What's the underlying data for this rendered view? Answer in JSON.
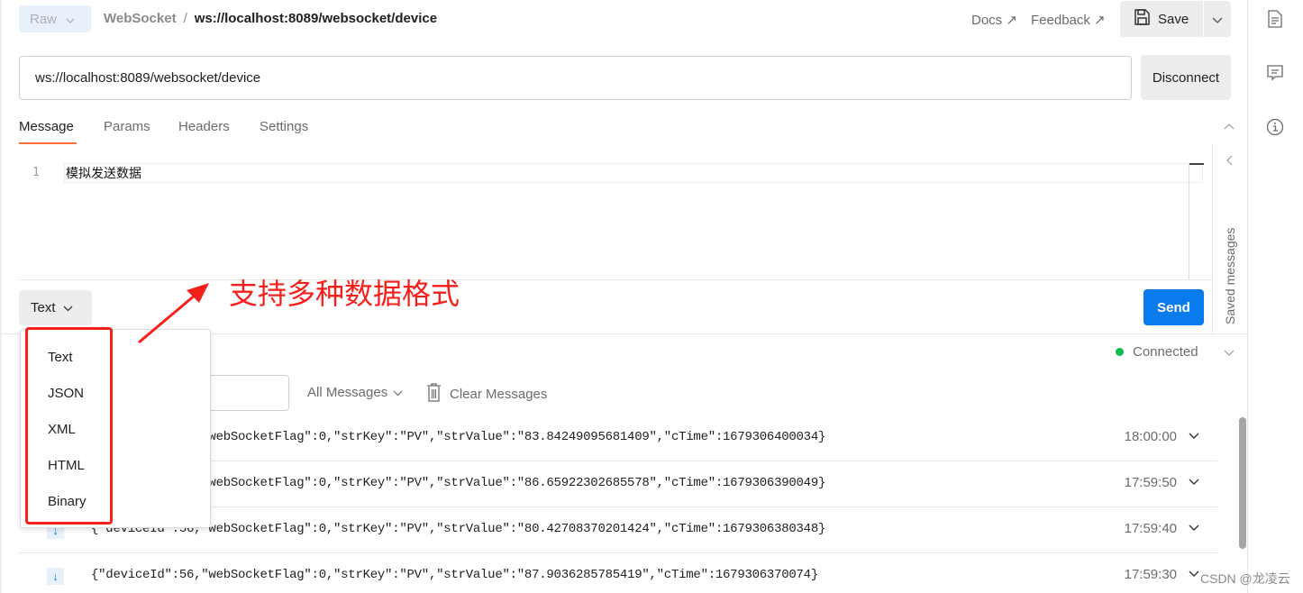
{
  "header": {
    "mode_button": "Raw",
    "breadcrumb": {
      "parent": "WebSocket",
      "separator": "/",
      "current": "ws://localhost:8089/websocket/device"
    },
    "docs_link": "Docs ↗",
    "feedback_link": "Feedback ↗",
    "save_label": "Save"
  },
  "request": {
    "url": "ws://localhost:8089/websocket/device",
    "disconnect_label": "Disconnect"
  },
  "tabs": [
    {
      "label": "Message",
      "active": true
    },
    {
      "label": "Params",
      "active": false
    },
    {
      "label": "Headers",
      "active": false
    },
    {
      "label": "Settings",
      "active": false
    }
  ],
  "editor": {
    "line_number": "1",
    "content": "模拟发送数据"
  },
  "saved_messages_label": "Saved messages",
  "format": {
    "selected": "Text",
    "options": [
      "Text",
      "JSON",
      "XML",
      "HTML",
      "Binary"
    ]
  },
  "send_label": "Send",
  "response": {
    "status": "Connected",
    "status_color": "#0cbb52",
    "filter_label": "All Messages",
    "clear_label": "Clear Messages",
    "messages": [
      {
        "text": "{\"deviceId\":56,\"webSocketFlag\":0,\"strKey\":\"PV\",\"strValue\":\"83.84249095681409\",\"cTime\":1679306400034}",
        "time": "18:00:00"
      },
      {
        "text": "{\"deviceId\":56,\"webSocketFlag\":0,\"strKey\":\"PV\",\"strValue\":\"86.65922302685578\",\"cTime\":1679306390049}",
        "time": "17:59:50"
      },
      {
        "text": "{\"deviceId\":56,\"webSocketFlag\":0,\"strKey\":\"PV\",\"strValue\":\"80.42708370201424\",\"cTime\":1679306380348}",
        "time": "17:59:40"
      },
      {
        "text": "{\"deviceId\":56,\"webSocketFlag\":0,\"strKey\":\"PV\",\"strValue\":\"87.9036285785419\",\"cTime\":1679306370074}",
        "time": "17:59:30"
      }
    ]
  },
  "annotation": {
    "text": "支持多种数据格式",
    "color": "#f5201b"
  },
  "watermark": "CSDN @龙凌云",
  "accent_color": "#ff6c37",
  "primary_color": "#097bed"
}
